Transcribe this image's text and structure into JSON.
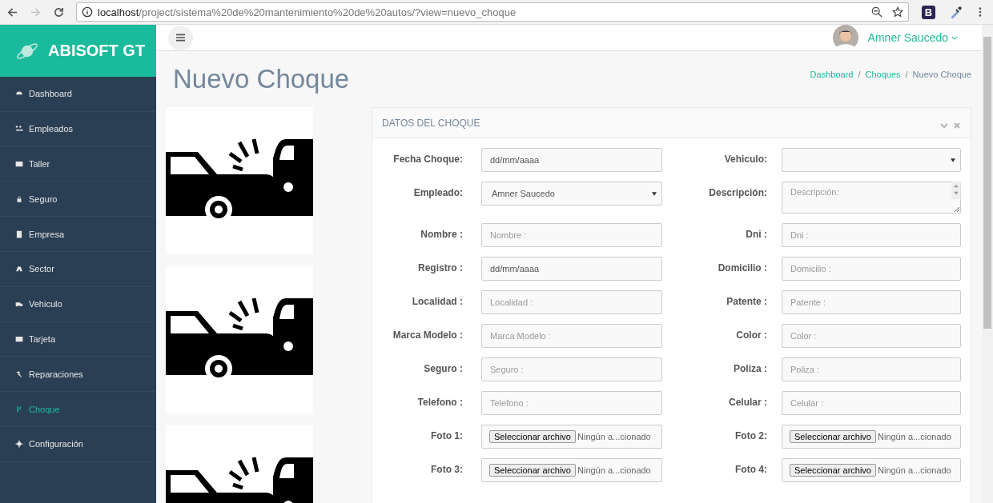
{
  "browser": {
    "url_host": "localhost",
    "url_path": "/project/sistema%20de%20mantenimiento%20de%20autos/?view=nuevo_choque",
    "extension_label": "B",
    "forward_disabled": true
  },
  "brand": {
    "name": "ABISOFT GT"
  },
  "sidebar": {
    "items": [
      {
        "label": "Dashboard",
        "selected": false
      },
      {
        "label": "Empleados",
        "selected": false
      },
      {
        "label": "Taller",
        "selected": false
      },
      {
        "label": "Seguro",
        "selected": false
      },
      {
        "label": "Empresa",
        "selected": false
      },
      {
        "label": "Sector",
        "selected": false
      },
      {
        "label": "Vehiculo",
        "selected": false
      },
      {
        "label": "Tarjeta",
        "selected": false
      },
      {
        "label": "Reparaciones",
        "selected": false
      },
      {
        "label": "Choque",
        "selected": true
      },
      {
        "label": "Configuración",
        "selected": false
      }
    ]
  },
  "user": {
    "name": "Amner Saucedo"
  },
  "page": {
    "title": "Nuevo Choque",
    "breadcrumb_separator": "/",
    "breadcrumb": [
      {
        "label": "Dashboard",
        "link": true
      },
      {
        "label": "Choques",
        "link": true
      },
      {
        "label": "Nuevo Choque",
        "link": false
      }
    ]
  },
  "panel": {
    "title": "DATOS DEL CHOQUE",
    "fields": [
      {
        "label": "Fecha Choque:",
        "kind": "date",
        "value": "dd/mm/aaaa"
      },
      {
        "label": "Vehiculo:",
        "kind": "select"
      },
      {
        "label": "Empleado:",
        "kind": "select",
        "value": "Amner Saucedo"
      },
      {
        "label": "Descripción:",
        "kind": "textarea",
        "placeholder": "Descripción:"
      },
      {
        "label": "Nombre :",
        "kind": "text",
        "placeholder": "Nombre :"
      },
      {
        "label": "Dni :",
        "kind": "text",
        "placeholder": "Dni :"
      },
      {
        "label": "Registro :",
        "kind": "date",
        "value": "dd/mm/aaaa"
      },
      {
        "label": "Domicilio :",
        "kind": "text",
        "placeholder": "Domicilio :"
      },
      {
        "label": "Localidad :",
        "kind": "text",
        "placeholder": "Localidad :"
      },
      {
        "label": "Patente :",
        "kind": "text",
        "placeholder": "Patente :"
      },
      {
        "label": "Marca Modelo :",
        "kind": "text",
        "placeholder": "Marca Modelo :"
      },
      {
        "label": "Color :",
        "kind": "text",
        "placeholder": "Color :"
      },
      {
        "label": "Seguro :",
        "kind": "text",
        "placeholder": "Seguro :"
      },
      {
        "label": "Poliza :",
        "kind": "text",
        "placeholder": "Poliza :"
      },
      {
        "label": "Telefono :",
        "kind": "text",
        "placeholder": "Telefono :"
      },
      {
        "label": "Celular :",
        "kind": "text",
        "placeholder": "Celular :"
      },
      {
        "label": "Foto 1:",
        "kind": "file",
        "button": "Seleccionar archivo",
        "status": "Ningún a...cionado"
      },
      {
        "label": "Foto 2:",
        "kind": "file",
        "button": "Seleccionar archivo",
        "status": "Ningún a...cionado"
      },
      {
        "label": "Foto 3:",
        "kind": "file",
        "button": "Seleccionar archivo",
        "status": "Ningún a...cionado"
      },
      {
        "label": "Foto 4:",
        "kind": "file",
        "button": "Seleccionar archivo",
        "status": "Ningún a...cionado"
      }
    ]
  }
}
